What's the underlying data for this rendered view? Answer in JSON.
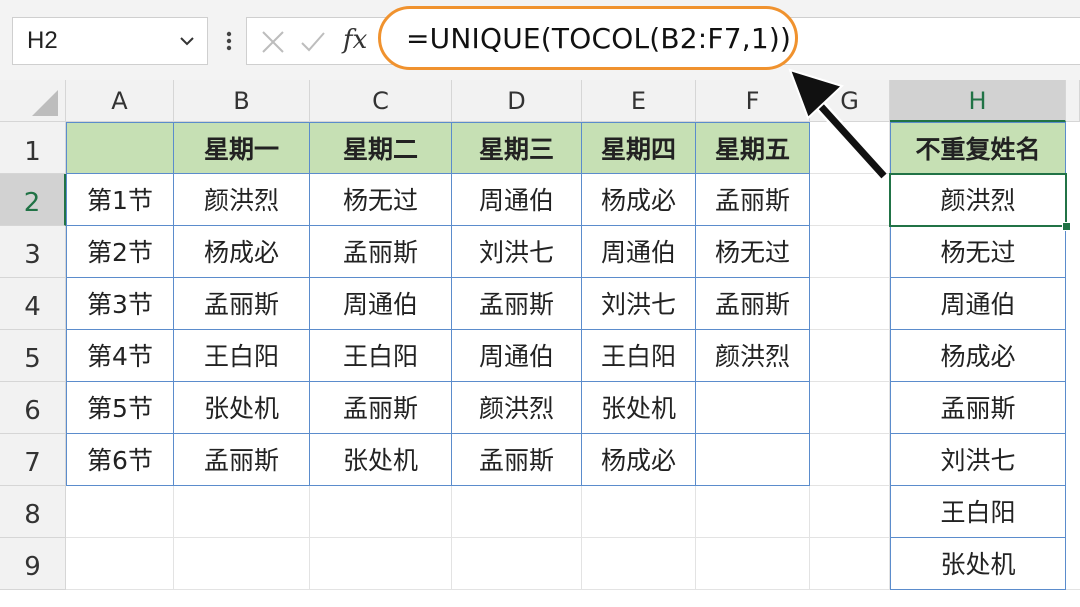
{
  "name_box": {
    "value": "H2"
  },
  "formula_bar": {
    "fx_label": "fx",
    "formula": "=UNIQUE(TOCOL(B2:F7,1))"
  },
  "columns": [
    "A",
    "B",
    "C",
    "D",
    "E",
    "F",
    "G",
    "H"
  ],
  "rows": [
    "1",
    "2",
    "3",
    "4",
    "5",
    "6",
    "7",
    "8",
    "9"
  ],
  "table": {
    "headers": [
      "",
      "星期一",
      "星期二",
      "星期三",
      "星期四",
      "星期五"
    ],
    "body": [
      [
        "第1节",
        "颜洪烈",
        "杨无过",
        "周通伯",
        "杨成必",
        "孟丽斯"
      ],
      [
        "第2节",
        "杨成必",
        "孟丽斯",
        "刘洪七",
        "周通伯",
        "杨无过"
      ],
      [
        "第3节",
        "孟丽斯",
        "周通伯",
        "孟丽斯",
        "刘洪七",
        "孟丽斯"
      ],
      [
        "第4节",
        "王白阳",
        "王白阳",
        "周通伯",
        "王白阳",
        "颜洪烈"
      ],
      [
        "第5节",
        "张处机",
        "孟丽斯",
        "颜洪烈",
        "张处机",
        ""
      ],
      [
        "第6节",
        "孟丽斯",
        "张处机",
        "孟丽斯",
        "杨成必",
        ""
      ]
    ]
  },
  "unique": {
    "header": "不重复姓名",
    "values": [
      "颜洪烈",
      "杨无过",
      "周通伯",
      "杨成必",
      "孟丽斯",
      "刘洪七",
      "王白阳",
      "张处机"
    ]
  },
  "colors": {
    "accent_green": "#217346",
    "header_fill": "#c6e0b4",
    "table_border": "#5b8ccc",
    "highlight_orange": "#f0922e"
  },
  "selection": {
    "active_cell": "H2",
    "selected_column": "H",
    "selected_row": "2"
  }
}
